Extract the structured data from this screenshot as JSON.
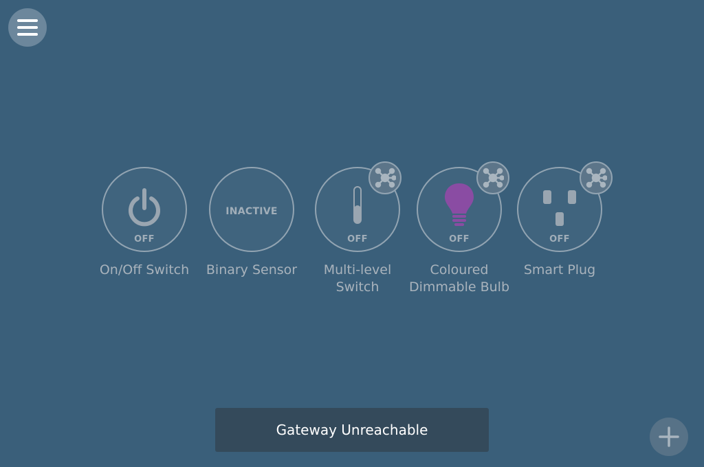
{
  "menu": {
    "icon": "hamburger-menu-icon"
  },
  "devices": [
    {
      "name": "On/Off Switch",
      "state": "OFF",
      "icon": "power-icon",
      "has_network_badge": false
    },
    {
      "name": "Binary Sensor",
      "state": "INACTIVE",
      "icon": "none",
      "has_network_badge": false
    },
    {
      "name": "Multi-level Switch",
      "state": "OFF",
      "icon": "slider-icon",
      "has_network_badge": true
    },
    {
      "name": "Coloured Dimmable Bulb",
      "state": "OFF",
      "icon": "lightbulb-icon",
      "has_network_badge": true,
      "bulb_color": "#8a4ca3"
    },
    {
      "name": "Smart Plug",
      "state": "OFF",
      "icon": "outlet-icon",
      "has_network_badge": true
    }
  ],
  "toast": {
    "message": "Gateway Unreachable"
  },
  "fab": {
    "icon": "plus-icon"
  },
  "colors": {
    "background": "#3a5f7a",
    "toast": "#344a5b",
    "bulb": "#8a4ca3"
  }
}
